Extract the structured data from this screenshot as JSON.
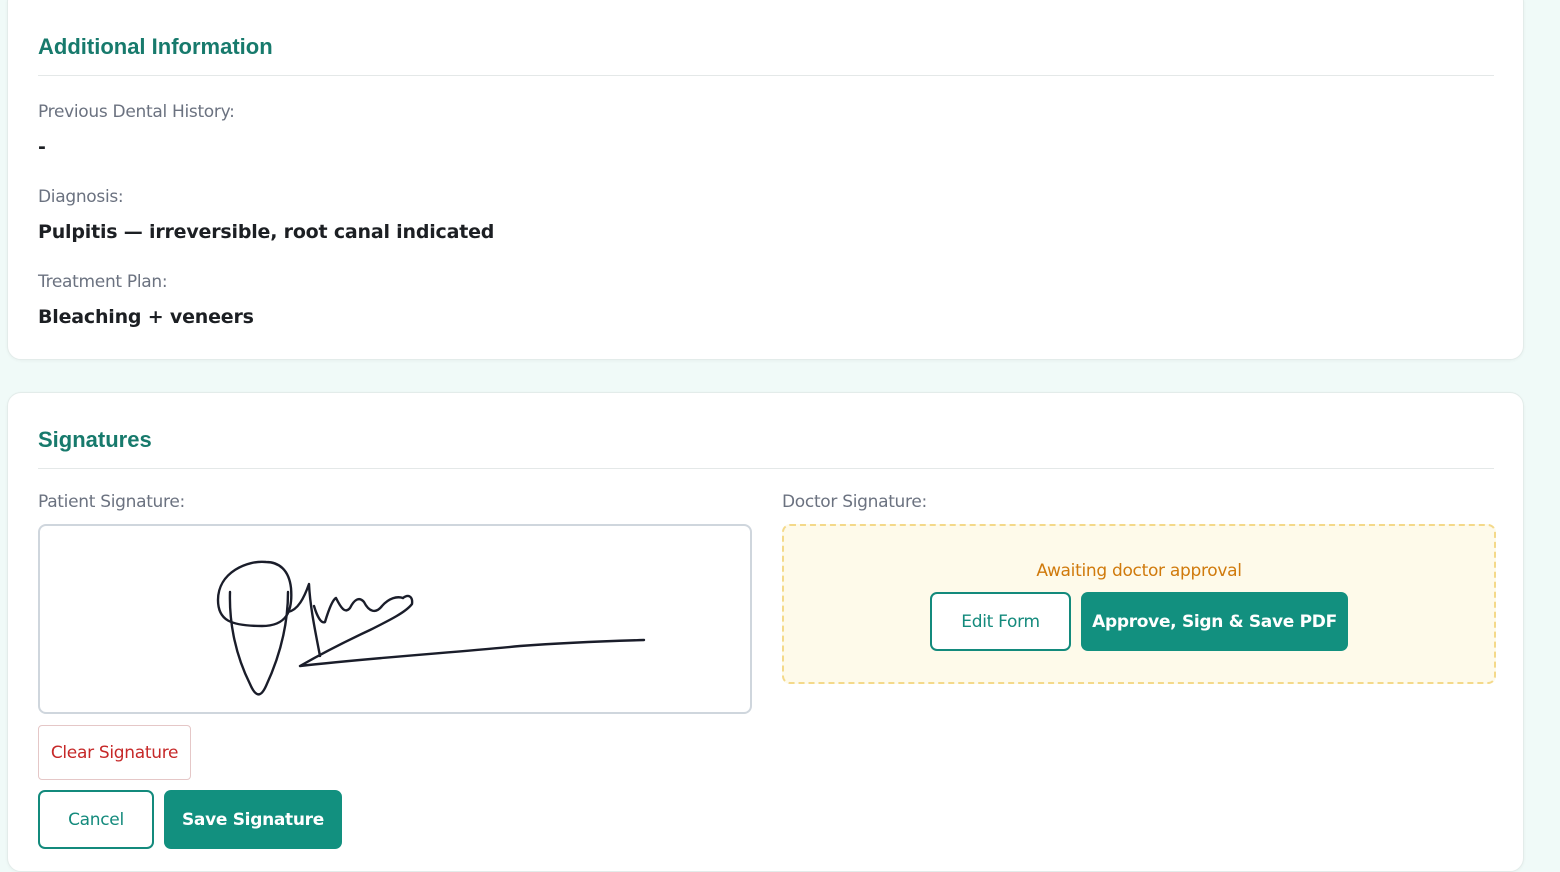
{
  "additional_info": {
    "title": "Additional Information",
    "fields": [
      {
        "label": "Previous Dental History:",
        "value": "-"
      },
      {
        "label": "Diagnosis:",
        "value": "Pulpitis — irreversible, root canal indicated"
      },
      {
        "label": "Treatment Plan:",
        "value": "Bleaching + veneers"
      }
    ]
  },
  "signatures": {
    "title": "Signatures",
    "patient": {
      "label": "Patient Signature:",
      "clear_label": "Clear Signature",
      "cancel_label": "Cancel",
      "save_label": "Save Signature"
    },
    "doctor": {
      "label": "Doctor Signature:",
      "status": "Awaiting doctor approval",
      "edit_label": "Edit Form",
      "approve_label": "Approve, Sign & Save PDF"
    }
  },
  "colors": {
    "accent": "#12907f",
    "title": "#177a6c",
    "danger": "#c62828",
    "warning_text": "#d07a0c",
    "warning_bg": "#fefaea"
  }
}
